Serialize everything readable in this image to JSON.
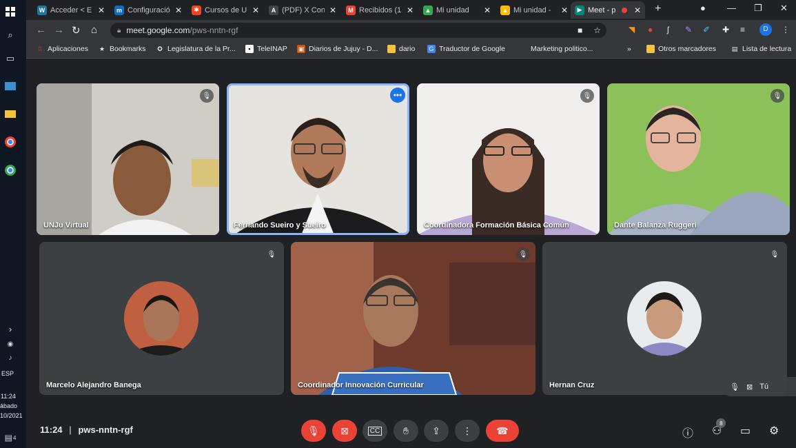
{
  "taskbar": {
    "language": "ESP",
    "time": "11:24",
    "day": "ábado",
    "date": "10/2021",
    "notifications": "4"
  },
  "tabs": [
    {
      "title": "Acceder < E",
      "icon": "wordpress-icon",
      "color": "#21759b"
    },
    {
      "title": "Configuració",
      "icon": "moodle-icon",
      "color": "#0f6cbf"
    },
    {
      "title": "Cursos de U",
      "icon": "joomla-icon",
      "color": "#f44321"
    },
    {
      "title": "(PDF) X Con",
      "icon": "academia-icon",
      "color": "#41454a"
    },
    {
      "title": "Recibidos (1",
      "icon": "gmail-icon",
      "color": "#ea4335"
    },
    {
      "title": "Mi unidad",
      "icon": "drive-icon",
      "color": "#34a853"
    },
    {
      "title": "Mi unidad -",
      "icon": "drive-icon",
      "color": "#fbbc04"
    },
    {
      "title": "Meet - p",
      "icon": "meet-icon",
      "color": "#00897b"
    }
  ],
  "address": {
    "host": "meet.google.com",
    "path": "/pws-nntn-rgf"
  },
  "bookmarks": [
    "Aplicaciones",
    "Bookmarks",
    "Legislatura de la Pr...",
    "TeleINAP",
    "Diarios de Jujuy - D...",
    "dario",
    "Traductor de Google",
    "Marketing politico...",
    "Otros marcadores",
    "Lista de lectura"
  ],
  "participants": [
    {
      "name": "UNJu Virtual"
    },
    {
      "name": "Fernando Sueiro y Sueiro"
    },
    {
      "name": "Coordinadora Formación Básica Común"
    },
    {
      "name": "Dante Balanza Ruggeri"
    },
    {
      "name": "Marcelo Alejandro Banega"
    },
    {
      "name": "Coordinador Innovación Curricular"
    },
    {
      "name": "Hernan Cruz"
    }
  ],
  "self_label": "Tú",
  "meeting": {
    "time": "11:24",
    "code": "pws-nntn-rgf"
  },
  "participant_count": "8",
  "colors": {
    "accent": "#8ab4f8",
    "danger": "#ea4335",
    "surface": "#3c4043",
    "background": "#202124"
  }
}
